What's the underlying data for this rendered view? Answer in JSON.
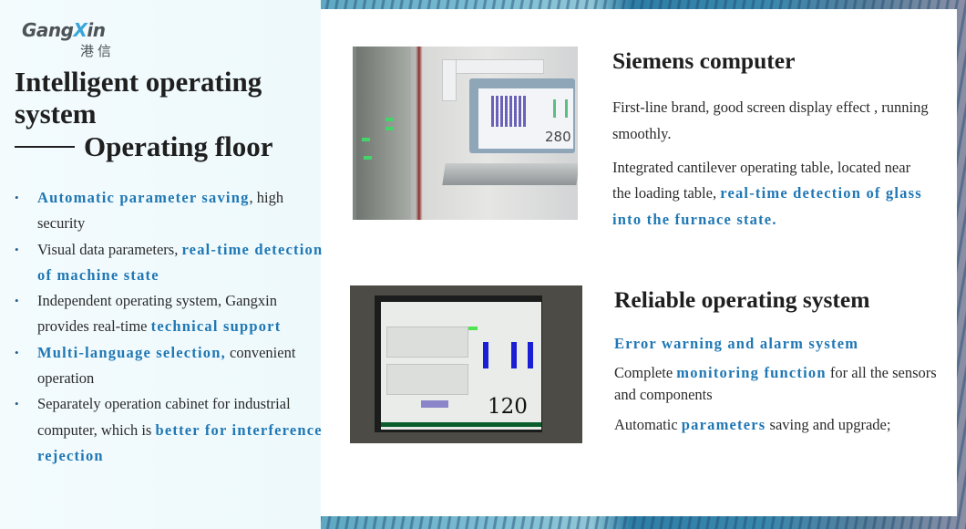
{
  "logo": {
    "name_before": "Gang",
    "name_x": "X",
    "name_after": "in",
    "chinese": "港信",
    "accent_color": "#3aa6d8",
    "text_color": "#4d5356"
  },
  "left": {
    "title": "Intelligent operating system",
    "subtitle": "Operating floor",
    "bullets": [
      {
        "parts": [
          {
            "t": "Automatic parameter saving",
            "hl": true
          },
          {
            "t": ", high security",
            "hl": false
          }
        ]
      },
      {
        "parts": [
          {
            "t": "Visual data parameters, ",
            "hl": false
          },
          {
            "t": "real-time detection of machine state",
            "hl": true
          }
        ]
      },
      {
        "parts": [
          {
            "t": "Independent operating system, Gangxin provides real-time ",
            "hl": false
          },
          {
            "t": "technical support",
            "hl": true
          }
        ]
      },
      {
        "parts": [
          {
            "t": "Multi-language selection,",
            "hl": true
          },
          {
            "t": " convenient operation",
            "hl": false
          }
        ]
      },
      {
        "parts": [
          {
            "t": "Separately operation cabinet for industrial computer, which is ",
            "hl": false
          },
          {
            "t": "better for interference rejection",
            "hl": true
          }
        ]
      }
    ]
  },
  "section1": {
    "heading": "Siemens computer",
    "para1": "First-line brand, good screen display effect , running smoothly.",
    "para2_plain": "Integrated cantilever operating table, located near the loading table, ",
    "para2_highlight": "real-time detection of glass into the furnace state.",
    "photo_alt": "Siemens computer on cantilever operating table",
    "photo_screen_value": "280"
  },
  "section2": {
    "heading": "Reliable operating system",
    "highlight_line": "Error warning and alarm system",
    "para1_plain1": "Complete ",
    "para1_highlight": "monitoring function",
    "para1_plain2": " for all the sensors and components",
    "para2_plain1": "Automatic ",
    "para2_highlight": "parameters",
    "para2_plain2": " saving and upgrade;",
    "photo_alt": "Operating system screen",
    "photo_screen_value": "120"
  },
  "colors": {
    "highlight": "#1f77b4",
    "body_text": "#2b2b2b",
    "heading": "#1f1f1f"
  }
}
